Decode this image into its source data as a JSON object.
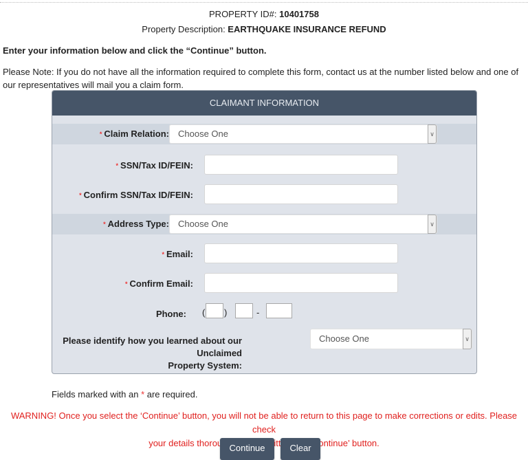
{
  "header": {
    "property_id_label": "PROPERTY ID#: ",
    "property_id_value": "10401758",
    "property_desc_label": "Property Description: ",
    "property_desc_value": "EARTHQUAKE INSURANCE REFUND"
  },
  "intro": "Enter your information below and click the “Continue” button.",
  "note": "Please Note: If you do not have all the information required to complete this form, contact us at the number listed below and one of our representatives will mail you a claim form.",
  "panel": {
    "title": "CLAIMANT INFORMATION",
    "required_marker": "*",
    "fields": {
      "claim_relation": {
        "label": "Claim Relation:",
        "value": "Choose One"
      },
      "ssn": {
        "label": "SSN/Tax ID/FEIN:",
        "value": ""
      },
      "confirm_ssn": {
        "label": "Confirm SSN/Tax ID/FEIN:",
        "value": ""
      },
      "address_type": {
        "label": "Address Type:",
        "value": "Choose One"
      },
      "email": {
        "label": "Email:",
        "value": ""
      },
      "confirm_email": {
        "label": "Confirm Email:",
        "value": ""
      },
      "phone": {
        "label": "Phone:",
        "open_paren": "(",
        "close_paren": ")",
        "dash": "-"
      },
      "learned_about": {
        "label_line1": "Please identify how you learned about our Unclaimed",
        "label_line2": "Property System:",
        "value": "Choose One"
      }
    },
    "chevron_glyph": "∨"
  },
  "footer": {
    "required_note_prefix": "Fields marked with an ",
    "required_note_star": "*",
    "required_note_suffix": " are required.",
    "warning_line1": "WARNING! Once you select the ‘Continue’ button, you will not be able to return to this page to make corrections or edits. Please check",
    "warning_line2": "your details thoroughly before hitting the ‘Continue’ button.",
    "continue_label": "Continue",
    "clear_label": "Clear"
  },
  "colors": {
    "panel_header": "#465568",
    "panel_body": "#dfe3ea",
    "band": "#cfd6df",
    "required": "#e33333",
    "warning": "#e0201e",
    "button": "#465568"
  }
}
